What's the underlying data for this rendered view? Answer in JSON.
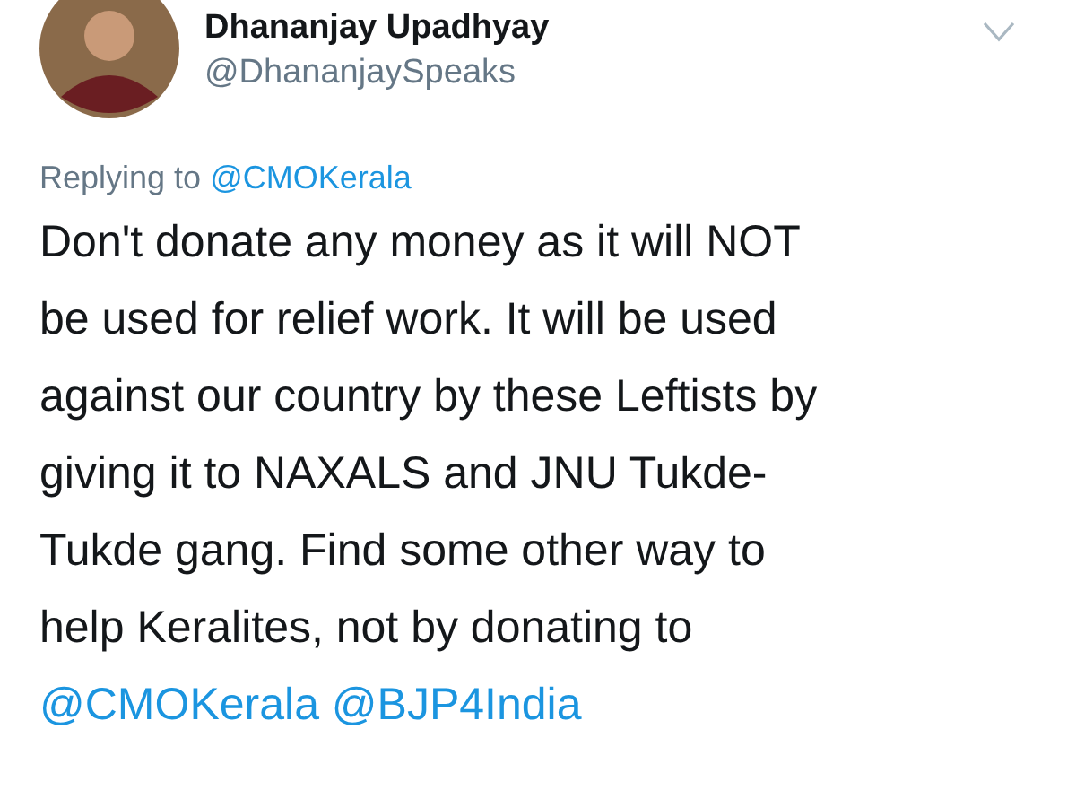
{
  "tweet": {
    "author": {
      "name": "Dhananjay Upadhyay",
      "handle": "@DhananjaySpeaks"
    },
    "reply_to": {
      "label": "Replying to",
      "mention": "@CMOKerala"
    },
    "lines": [
      {
        "kind": "text",
        "text": "Don't donate any money as it will NOT"
      },
      {
        "kind": "text",
        "text": "be used for relief work. It will be used"
      },
      {
        "kind": "text",
        "text": "against our country by these Leftists by"
      },
      {
        "kind": "text",
        "text": "giving it to NAXALS and JNU Tukde-"
      },
      {
        "kind": "text",
        "text": "Tukde gang. Find some other way to"
      },
      {
        "kind": "text",
        "text": "help Keralites, not by donating to"
      },
      {
        "kind": "mention",
        "text": "@CMOKerala  @BJP4India"
      }
    ]
  }
}
